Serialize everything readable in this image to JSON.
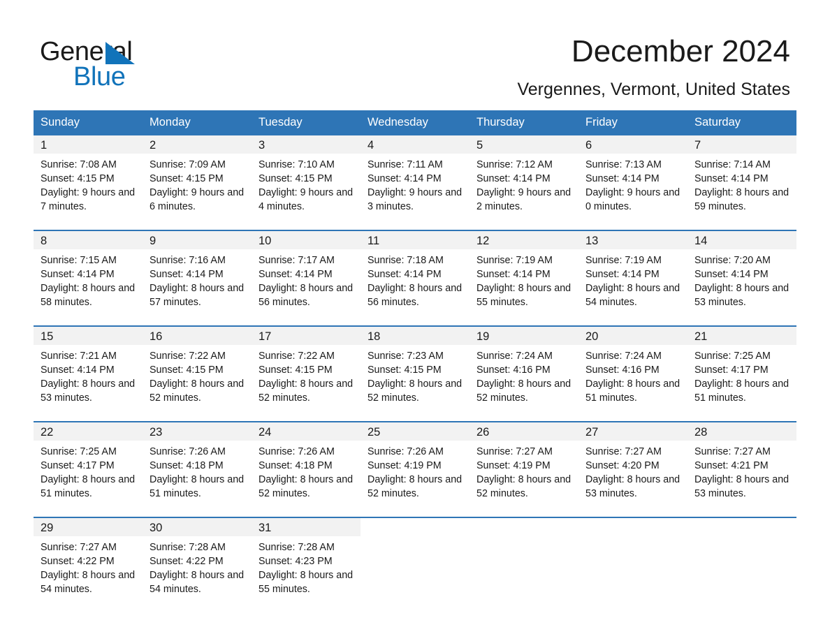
{
  "logo": {
    "word_one": "General",
    "word_two": "Blue",
    "triangle_color": "#1173ba"
  },
  "header": {
    "title": "December 2024",
    "subtitle": "Vergennes, Vermont, United States"
  },
  "colors": {
    "header_blue": "#2e75b6",
    "day_bar_gray": "#f2f2f2",
    "text": "#1a1a1a",
    "logo_blue": "#1173ba"
  },
  "calendar": {
    "weekday_headers": [
      "Sunday",
      "Monday",
      "Tuesday",
      "Wednesday",
      "Thursday",
      "Friday",
      "Saturday"
    ],
    "weeks": [
      [
        {
          "day": "1",
          "sunrise": "Sunrise: 7:08 AM",
          "sunset": "Sunset: 4:15 PM",
          "daylight": "Daylight: 9 hours and 7 minutes."
        },
        {
          "day": "2",
          "sunrise": "Sunrise: 7:09 AM",
          "sunset": "Sunset: 4:15 PM",
          "daylight": "Daylight: 9 hours and 6 minutes."
        },
        {
          "day": "3",
          "sunrise": "Sunrise: 7:10 AM",
          "sunset": "Sunset: 4:15 PM",
          "daylight": "Daylight: 9 hours and 4 minutes."
        },
        {
          "day": "4",
          "sunrise": "Sunrise: 7:11 AM",
          "sunset": "Sunset: 4:14 PM",
          "daylight": "Daylight: 9 hours and 3 minutes."
        },
        {
          "day": "5",
          "sunrise": "Sunrise: 7:12 AM",
          "sunset": "Sunset: 4:14 PM",
          "daylight": "Daylight: 9 hours and 2 minutes."
        },
        {
          "day": "6",
          "sunrise": "Sunrise: 7:13 AM",
          "sunset": "Sunset: 4:14 PM",
          "daylight": "Daylight: 9 hours and 0 minutes."
        },
        {
          "day": "7",
          "sunrise": "Sunrise: 7:14 AM",
          "sunset": "Sunset: 4:14 PM",
          "daylight": "Daylight: 8 hours and 59 minutes."
        }
      ],
      [
        {
          "day": "8",
          "sunrise": "Sunrise: 7:15 AM",
          "sunset": "Sunset: 4:14 PM",
          "daylight": "Daylight: 8 hours and 58 minutes."
        },
        {
          "day": "9",
          "sunrise": "Sunrise: 7:16 AM",
          "sunset": "Sunset: 4:14 PM",
          "daylight": "Daylight: 8 hours and 57 minutes."
        },
        {
          "day": "10",
          "sunrise": "Sunrise: 7:17 AM",
          "sunset": "Sunset: 4:14 PM",
          "daylight": "Daylight: 8 hours and 56 minutes."
        },
        {
          "day": "11",
          "sunrise": "Sunrise: 7:18 AM",
          "sunset": "Sunset: 4:14 PM",
          "daylight": "Daylight: 8 hours and 56 minutes."
        },
        {
          "day": "12",
          "sunrise": "Sunrise: 7:19 AM",
          "sunset": "Sunset: 4:14 PM",
          "daylight": "Daylight: 8 hours and 55 minutes."
        },
        {
          "day": "13",
          "sunrise": "Sunrise: 7:19 AM",
          "sunset": "Sunset: 4:14 PM",
          "daylight": "Daylight: 8 hours and 54 minutes."
        },
        {
          "day": "14",
          "sunrise": "Sunrise: 7:20 AM",
          "sunset": "Sunset: 4:14 PM",
          "daylight": "Daylight: 8 hours and 53 minutes."
        }
      ],
      [
        {
          "day": "15",
          "sunrise": "Sunrise: 7:21 AM",
          "sunset": "Sunset: 4:14 PM",
          "daylight": "Daylight: 8 hours and 53 minutes."
        },
        {
          "day": "16",
          "sunrise": "Sunrise: 7:22 AM",
          "sunset": "Sunset: 4:15 PM",
          "daylight": "Daylight: 8 hours and 52 minutes."
        },
        {
          "day": "17",
          "sunrise": "Sunrise: 7:22 AM",
          "sunset": "Sunset: 4:15 PM",
          "daylight": "Daylight: 8 hours and 52 minutes."
        },
        {
          "day": "18",
          "sunrise": "Sunrise: 7:23 AM",
          "sunset": "Sunset: 4:15 PM",
          "daylight": "Daylight: 8 hours and 52 minutes."
        },
        {
          "day": "19",
          "sunrise": "Sunrise: 7:24 AM",
          "sunset": "Sunset: 4:16 PM",
          "daylight": "Daylight: 8 hours and 52 minutes."
        },
        {
          "day": "20",
          "sunrise": "Sunrise: 7:24 AM",
          "sunset": "Sunset: 4:16 PM",
          "daylight": "Daylight: 8 hours and 51 minutes."
        },
        {
          "day": "21",
          "sunrise": "Sunrise: 7:25 AM",
          "sunset": "Sunset: 4:17 PM",
          "daylight": "Daylight: 8 hours and 51 minutes."
        }
      ],
      [
        {
          "day": "22",
          "sunrise": "Sunrise: 7:25 AM",
          "sunset": "Sunset: 4:17 PM",
          "daylight": "Daylight: 8 hours and 51 minutes."
        },
        {
          "day": "23",
          "sunrise": "Sunrise: 7:26 AM",
          "sunset": "Sunset: 4:18 PM",
          "daylight": "Daylight: 8 hours and 51 minutes."
        },
        {
          "day": "24",
          "sunrise": "Sunrise: 7:26 AM",
          "sunset": "Sunset: 4:18 PM",
          "daylight": "Daylight: 8 hours and 52 minutes."
        },
        {
          "day": "25",
          "sunrise": "Sunrise: 7:26 AM",
          "sunset": "Sunset: 4:19 PM",
          "daylight": "Daylight: 8 hours and 52 minutes."
        },
        {
          "day": "26",
          "sunrise": "Sunrise: 7:27 AM",
          "sunset": "Sunset: 4:19 PM",
          "daylight": "Daylight: 8 hours and 52 minutes."
        },
        {
          "day": "27",
          "sunrise": "Sunrise: 7:27 AM",
          "sunset": "Sunset: 4:20 PM",
          "daylight": "Daylight: 8 hours and 53 minutes."
        },
        {
          "day": "28",
          "sunrise": "Sunrise: 7:27 AM",
          "sunset": "Sunset: 4:21 PM",
          "daylight": "Daylight: 8 hours and 53 minutes."
        }
      ],
      [
        {
          "day": "29",
          "sunrise": "Sunrise: 7:27 AM",
          "sunset": "Sunset: 4:22 PM",
          "daylight": "Daylight: 8 hours and 54 minutes."
        },
        {
          "day": "30",
          "sunrise": "Sunrise: 7:28 AM",
          "sunset": "Sunset: 4:22 PM",
          "daylight": "Daylight: 8 hours and 54 minutes."
        },
        {
          "day": "31",
          "sunrise": "Sunrise: 7:28 AM",
          "sunset": "Sunset: 4:23 PM",
          "daylight": "Daylight: 8 hours and 55 minutes."
        },
        null,
        null,
        null,
        null
      ]
    ]
  }
}
